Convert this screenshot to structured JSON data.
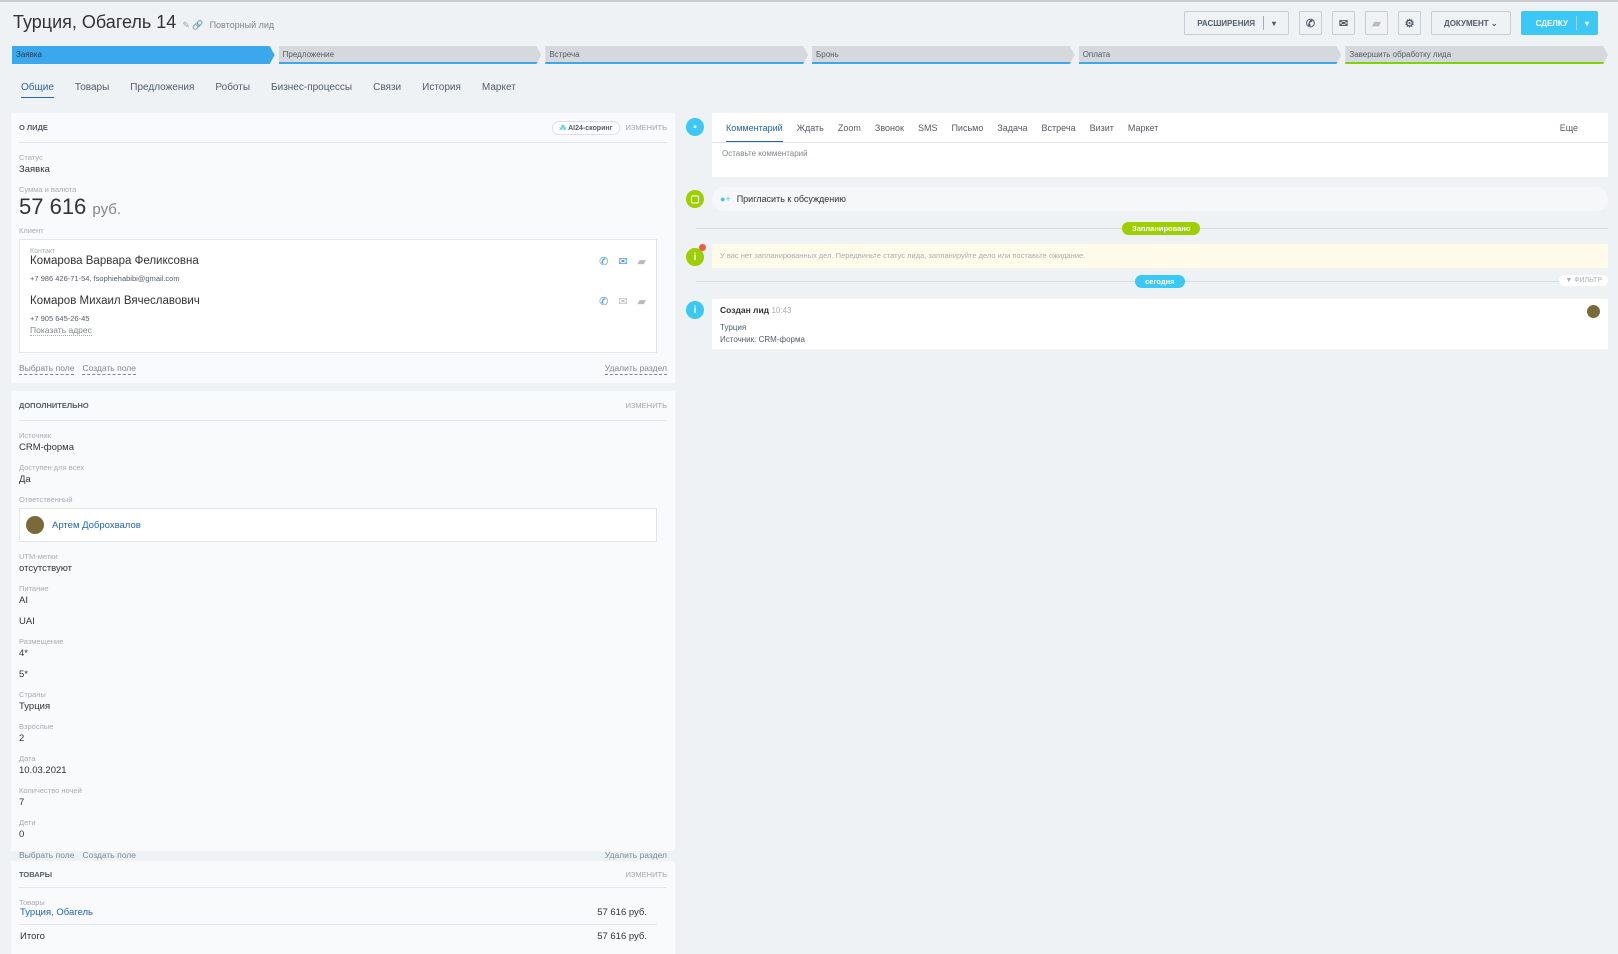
{
  "header": {
    "title": "Турция, Обагель 14",
    "repeat_lead": "Повторный лид",
    "extensions": "РАСШИРЕНИЯ",
    "document": "ДОКУМЕНТ",
    "deal": "СДЕЛКУ"
  },
  "stages": [
    "Заявка",
    "Предложение",
    "Встреча",
    "Бронь",
    "Оплата",
    "Завершить обработку лида"
  ],
  "tabs": [
    "Общие",
    "Товары",
    "Предложения",
    "Роботы",
    "Бизнес-процессы",
    "Связи",
    "История",
    "Маркет"
  ],
  "about": {
    "title": "о лиде",
    "ai": "AI24-скоринг",
    "change": "изменить",
    "status_label": "Статус",
    "status": "Заявка",
    "sum_label": "Сумма и валюта",
    "sum": "57 616",
    "currency": "руб.",
    "client_label": "Клиент",
    "contact_label": "Контакт",
    "contacts": [
      {
        "name": "Комарова Варвара Феликсовна",
        "info": "+7 986 426-71-54, fsophiehabibi@gmail.com"
      },
      {
        "name": "Комаров Михаил Вячеславович",
        "info": "+7 905 645-26-45",
        "address": "Показать адрес"
      }
    ],
    "select_field": "Выбрать поле",
    "create_field": "Создать поле",
    "delete_section": "Удалить раздел"
  },
  "extra": {
    "title": "дополнительно",
    "change": "изменить",
    "fields": [
      {
        "label": "Источник",
        "values": [
          "CRM-форма"
        ]
      },
      {
        "label": "Доступен для всех",
        "values": [
          "Да"
        ]
      },
      {
        "label": "Ответственный",
        "person": "Артем Доброхвалов"
      },
      {
        "label": "UTM-метки",
        "values": [
          "отсутствуют"
        ]
      },
      {
        "label": "Питание",
        "values": [
          "AI",
          "UAI"
        ]
      },
      {
        "label": "Размещение",
        "values": [
          "4*",
          "5*"
        ]
      },
      {
        "label": "Страны",
        "values": [
          "Турция"
        ]
      },
      {
        "label": "Взрослые",
        "values": [
          "2"
        ]
      },
      {
        "label": "Дата",
        "values": [
          "10.03.2021"
        ]
      },
      {
        "label": "Количество ночей",
        "values": [
          "7"
        ]
      },
      {
        "label": "Дети",
        "values": [
          "0"
        ]
      }
    ],
    "select_field": "Выбрать поле",
    "create_field": "Создать поле",
    "delete_section": "Удалить раздел"
  },
  "goods": {
    "title": "товары",
    "change": "изменить",
    "label": "Товары",
    "item": "Турция, Обагель",
    "item_price": "57 616 руб.",
    "total_label": "Итого",
    "total": "57 616 руб."
  },
  "timeline": {
    "tabs": [
      "Комментарий",
      "Ждать",
      "Zoom",
      "Звонок",
      "SMS",
      "Письмо",
      "Задача",
      "Встреча",
      "Визит",
      "Маркет"
    ],
    "more": "Еще",
    "comment_placeholder": "Оставьте комментарий",
    "invite": "Пригласить к обсуждению",
    "planned": "Запланировано",
    "no_tasks": "У вас нет запланированных дел. Передвиньте статус лида, запланируйте дело или поставьте ожидание.",
    "today": "сегодня",
    "filter": "ФИЛЬТР",
    "event_title": "Создан лид",
    "event_time": "10:43",
    "event_lines": [
      "Турция",
      "Источник: CRM-форма"
    ]
  }
}
